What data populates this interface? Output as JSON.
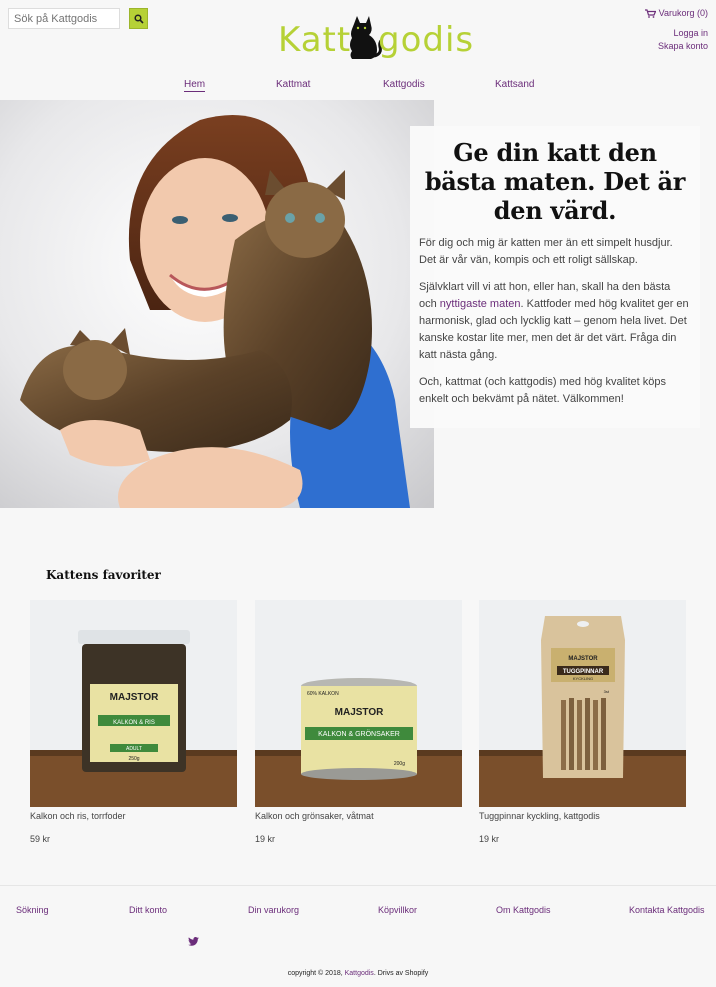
{
  "header": {
    "search_placeholder": "Sök på Kattgodis",
    "logo_left": "Katt",
    "logo_right": "godis",
    "cart_label": "Varukorg (0)",
    "login": "Logga in",
    "create_account": "Skapa konto",
    "accent_color": "#b6d136"
  },
  "nav": {
    "items": [
      "Hem",
      "Kattmat",
      "Kattgodis",
      "Kattsand"
    ]
  },
  "hero": {
    "heading": "Ge din katt den bästa maten. Det är den värd.",
    "p1": "För dig och mig är katten mer än ett simpelt husdjur. Det är vår vän, kompis och ett roligt sällskap.",
    "p2_before": "Självklart vill vi att hon, eller han, skall ha den bästa och ",
    "p2_link": "nyttigaste maten",
    "p2_after": ". Kattfoder med hög kvalitet ger en harmonisk, glad och lycklig katt – genom hela livet. Det kanske kostar lite mer, men det är det värt. Fråga din katt nästa gång.",
    "p3": "Och, kattmat (och kattgodis) med hög kvalitet köps enkelt och bekvämt på nätet. Välkommen!"
  },
  "favorites": {
    "title": "Kattens favoriter",
    "products": [
      {
        "name": "Kalkon och ris, torrfoder",
        "price": "59 kr",
        "label_brand": "MAJSTOR",
        "label_sub": "KALKON & RIS",
        "label_extra": "ADULT",
        "label_weight": "250g"
      },
      {
        "name": "Kalkon och grönsaker, våtmat",
        "price": "19 kr",
        "label_brand": "MAJSTOR",
        "label_sub": "KALKON & GRÖNSAKER",
        "label_extra": "60% KALKON",
        "label_weight": "200g"
      },
      {
        "name": "Tuggpinnar kyckling, kattgodis",
        "price": "19 kr",
        "label_brand": "MAJSTOR",
        "label_sub": "TUGGPINNAR",
        "label_extra": "KYCKLING",
        "label_weight": "3st"
      }
    ]
  },
  "footer": {
    "links": [
      "Sökning",
      "Ditt konto",
      "Din varukorg",
      "Köpvillkor",
      "Om Kattgodis",
      "Kontakta Kattgodis"
    ],
    "copyright_prefix": "copyright © 2018, ",
    "copyright_link": "Kattgodis",
    "copyright_suffix": ". Drivs av Shopify"
  }
}
